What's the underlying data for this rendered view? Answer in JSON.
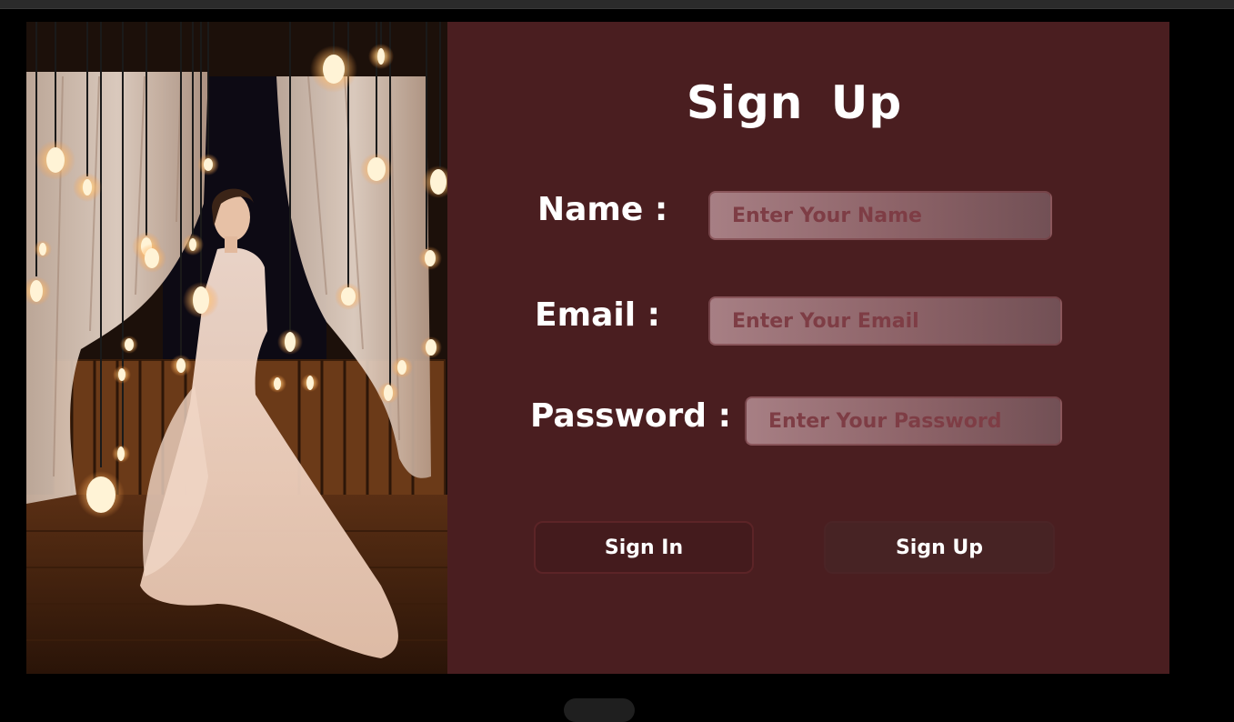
{
  "form": {
    "title": "Sign  Up",
    "fields": [
      {
        "label": "Name :",
        "placeholder": "Enter Your Name",
        "value": ""
      },
      {
        "label": "Email :",
        "placeholder": "Enter Your Email",
        "value": ""
      },
      {
        "label": "Password :",
        "placeholder": "Enter Your Password",
        "value": ""
      }
    ],
    "buttons": {
      "sign_in": "Sign In",
      "sign_up": "Sign Up"
    }
  },
  "colors": {
    "page_background": "#000000",
    "panel_background": "#4a1e20",
    "field_fill": "#a77f84",
    "placeholder_text": "#7e3d45",
    "button_fill": "#441b1d",
    "text": "#ffffff"
  }
}
